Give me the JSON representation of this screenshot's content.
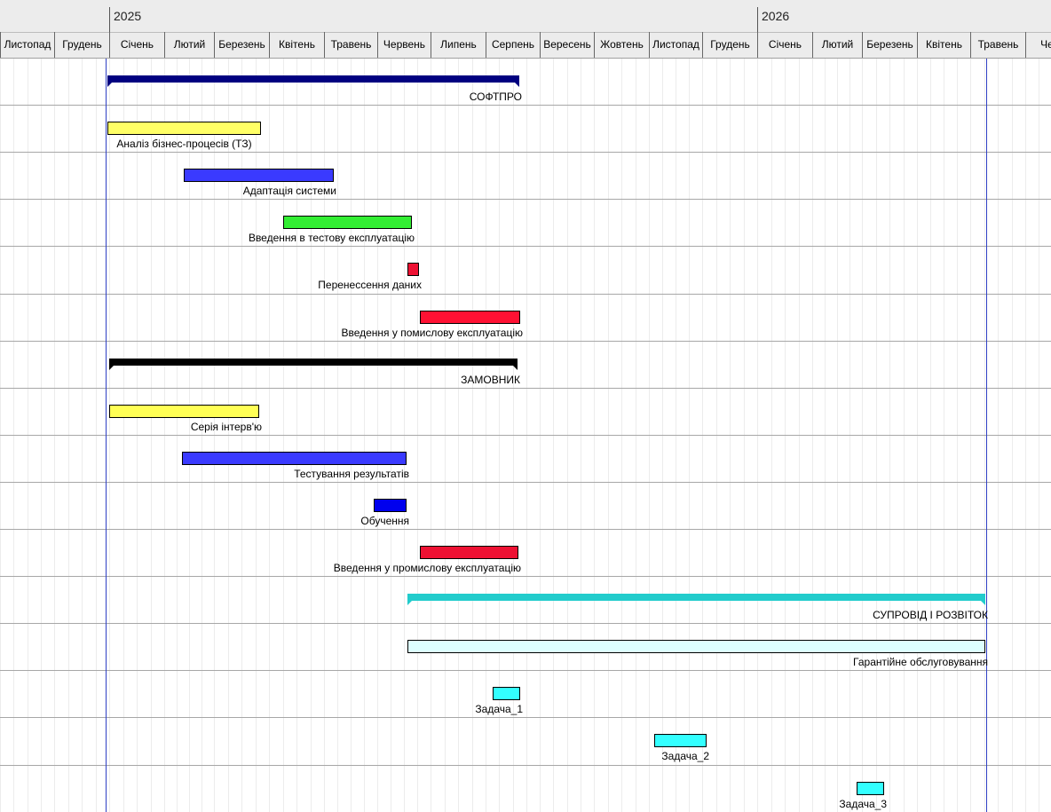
{
  "timeline": {
    "years": [
      "2025",
      "2026"
    ],
    "months": [
      "Листопад",
      "Грудень",
      "Січень",
      "Лютий",
      "Березень",
      "Квітень",
      "Травень",
      "Червень",
      "Липень",
      "Серпень",
      "Вересень",
      "Жовтень",
      "Листопад",
      "Грудень",
      "Січень",
      "Лютий",
      "Березень",
      "Квітень",
      "Травень",
      "Черв"
    ]
  },
  "tasks": [
    {
      "label": "СОФТПРО",
      "kind": "summary",
      "color": "#000080"
    },
    {
      "label": "Аналіз бізнес-процесів (ТЗ)",
      "kind": "task",
      "color": "#ffff66"
    },
    {
      "label": "Адаптація системи",
      "kind": "task",
      "color": "#3a3aff"
    },
    {
      "label": "Введення в тестову експлуатацію",
      "kind": "task",
      "color": "#33ee33"
    },
    {
      "label": "Перенессення даних",
      "kind": "task",
      "color": "#ee1133"
    },
    {
      "label": "Введення у помислову експлуатацію",
      "kind": "task",
      "color": "#ff1133"
    },
    {
      "label": "ЗАМОВНИК",
      "kind": "summary",
      "color": "#000000"
    },
    {
      "label": "Серія інтерв'ю",
      "kind": "task",
      "color": "#ffff55"
    },
    {
      "label": "Тестування результатів",
      "kind": "task",
      "color": "#3a3aff"
    },
    {
      "label": "Обучення",
      "kind": "task",
      "color": "#0000ee"
    },
    {
      "label": "Введення у промислову експлуатацію",
      "kind": "task",
      "color": "#ee1133"
    },
    {
      "label": "СУПРОВІД І РОЗВІТОК",
      "kind": "summary",
      "color": "#22cccc"
    },
    {
      "label": "Гарантійне обслуговування",
      "kind": "task",
      "color": "#ddffff"
    },
    {
      "label": "Задача_1",
      "kind": "task",
      "color": "#33ffff"
    },
    {
      "label": "Задача_2",
      "kind": "task",
      "color": "#33ffff"
    },
    {
      "label": "Задача_3",
      "kind": "task",
      "color": "#33ffff"
    }
  ]
}
